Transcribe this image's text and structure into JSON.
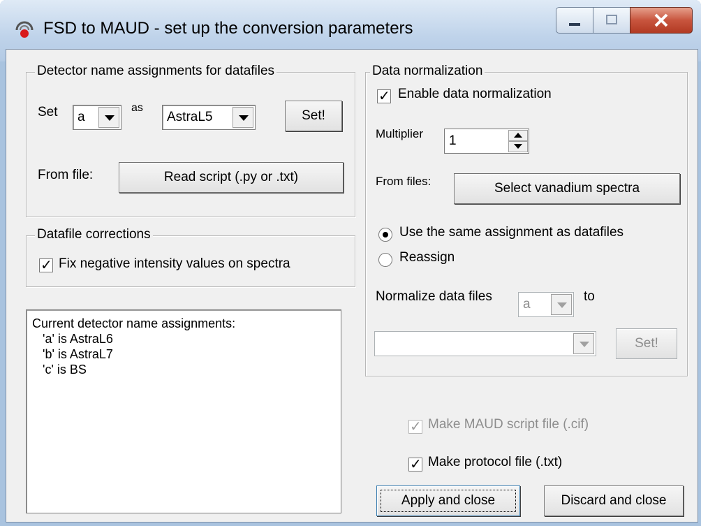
{
  "window": {
    "title": "FSD to MAUD - set up the conversion parameters"
  },
  "detector_group": {
    "legend": "Detector name assignments for datafiles",
    "set_label": "Set",
    "letter_value": "a",
    "as_label": "as",
    "detector_value": "AstraL5",
    "set_button": "Set!",
    "from_file_label": "From file:",
    "read_script_button": "Read script (.py or .txt)"
  },
  "corrections_group": {
    "legend": "Datafile corrections",
    "fix_negative_label": "Fix negative intensity values on spectra",
    "fix_negative_checked": true
  },
  "assignments_list": {
    "lines": [
      "Current detector name assignments:",
      "   'a' is AstraL6",
      "   'b' is AstraL7",
      "   'c' is BS"
    ]
  },
  "normalization_group": {
    "legend": "Data normalization",
    "enable_label": "Enable data normalization",
    "enable_checked": true,
    "multiplier_label": "Multiplier",
    "multiplier_value": "1",
    "from_files_label": "From files:",
    "select_vanadium_button": "Select vanadium spectra",
    "radio_same_label": "Use the same assignment as datafiles",
    "radio_reassign_label": "Reassign",
    "selected_radio": "same",
    "normalize_label": "Normalize data files",
    "normalize_letter": "a",
    "to_label": "to",
    "target_value": "",
    "set_button": "Set!"
  },
  "options": {
    "maud_script_label": "Make MAUD script file (.cif)",
    "maud_script_checked": true,
    "maud_script_enabled": false,
    "protocol_label": "Make protocol file (.txt)",
    "protocol_checked": true
  },
  "footer": {
    "apply_button": "Apply and close",
    "discard_button": "Discard and close"
  }
}
